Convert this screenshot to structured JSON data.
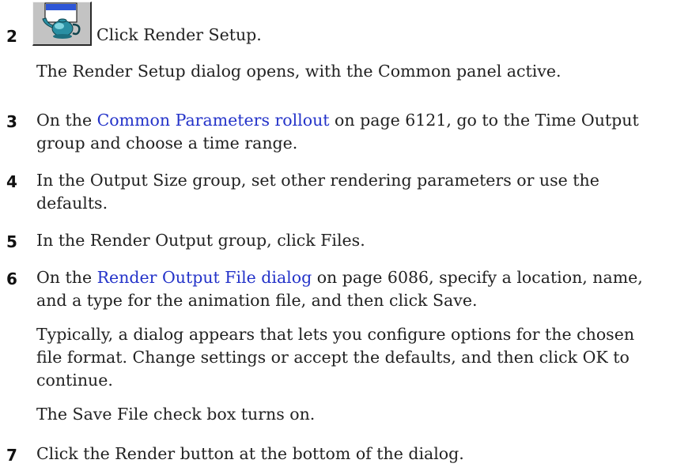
{
  "steps": {
    "s2": {
      "number": "2",
      "text": "Click Render Setup.",
      "note": "The Render Setup dialog opens, with the Common panel active."
    },
    "s3": {
      "number": "3",
      "pre": "On the ",
      "link": "Common Parameters rollout",
      "post1": " on page 6121, go to the Time Output",
      "line2": "group and choose a time range."
    },
    "s4": {
      "number": "4",
      "line1": "In the Output Size group, set other rendering parameters or use the",
      "line2": "defaults."
    },
    "s5": {
      "number": "5",
      "text": "In the Render Output group, click Files."
    },
    "s6": {
      "number": "6",
      "pre": "On the ",
      "link": "Render Output File dialog",
      "post1": " on page 6086, specify a location, name,",
      "line2": "and a type for the animation file, and then click Save.",
      "note1": "Typically, a dialog appears that lets you configure options for the chosen",
      "note2": "file format. Change settings or accept the defaults, and then click OK to",
      "note3": "continue.",
      "note4": "The Save File check box turns on."
    },
    "s7": {
      "number": "7",
      "text": "Click the Render button at the bottom of the dialog."
    }
  },
  "icons": {
    "render_setup": "render-setup-teapot-icon"
  },
  "colors": {
    "link": "#2433c9",
    "text": "#222222"
  }
}
